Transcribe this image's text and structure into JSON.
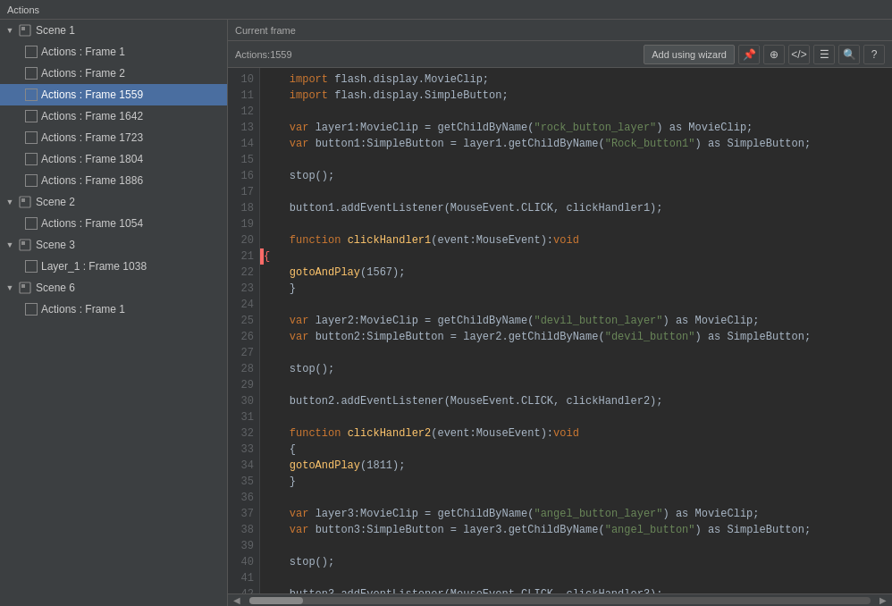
{
  "titleBar": {
    "label": "Actions"
  },
  "leftPanel": {
    "scenes": [
      {
        "id": "scene1",
        "label": "Scene 1",
        "expanded": true,
        "children": [
          {
            "id": "s1f1",
            "label": "Actions : Frame 1",
            "selected": false
          },
          {
            "id": "s1f2",
            "label": "Actions : Frame 2",
            "selected": false
          },
          {
            "id": "s1f1559",
            "label": "Actions : Frame 1559",
            "selected": true
          },
          {
            "id": "s1f1642",
            "label": "Actions : Frame 1642",
            "selected": false
          },
          {
            "id": "s1f1723",
            "label": "Actions : Frame 1723",
            "selected": false
          },
          {
            "id": "s1f1804",
            "label": "Actions : Frame 1804",
            "selected": false
          },
          {
            "id": "s1f1886",
            "label": "Actions : Frame 1886",
            "selected": false
          }
        ]
      },
      {
        "id": "scene2",
        "label": "Scene 2",
        "expanded": true,
        "children": [
          {
            "id": "s2f1054",
            "label": "Actions : Frame 1054",
            "selected": false
          }
        ]
      },
      {
        "id": "scene3",
        "label": "Scene 3",
        "expanded": true,
        "children": [
          {
            "id": "s3l1f1038",
            "label": "Layer_1 : Frame 1038",
            "selected": false
          }
        ]
      },
      {
        "id": "scene6",
        "label": "Scene 6",
        "expanded": true,
        "children": [
          {
            "id": "s6f1",
            "label": "Actions : Frame 1",
            "selected": false
          }
        ]
      }
    ]
  },
  "rightPanel": {
    "header": "Current frame",
    "breadcrumb": "Actions:1559",
    "toolbar": {
      "addWizard": "Add using wizard",
      "icons": [
        "pin-icon",
        "target-icon",
        "code-icon",
        "list-icon",
        "search-icon",
        "help-icon"
      ]
    }
  },
  "colors": {
    "selected": "#4a6ea0",
    "background": "#2b2b2b",
    "panel": "#3c3f41"
  }
}
